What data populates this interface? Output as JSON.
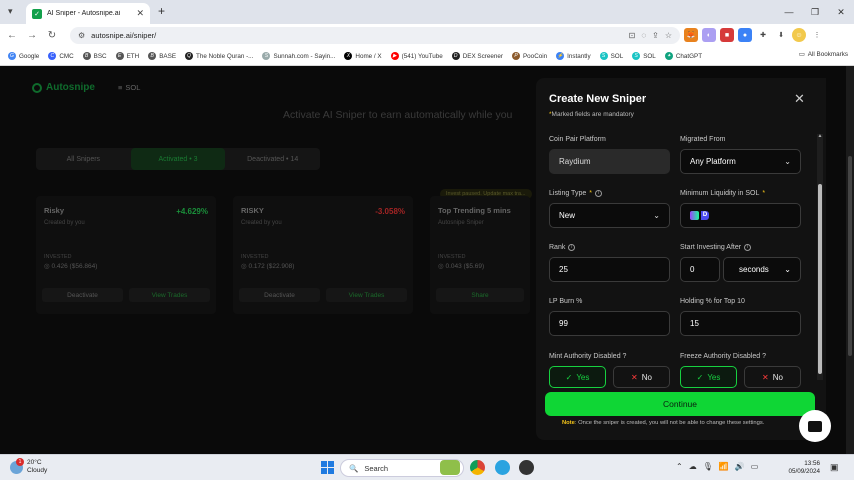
{
  "browser": {
    "tab_title": "AI Sniper - Autosnipe.ai",
    "url": "autosnipe.ai/sniper/",
    "bookmarks": [
      "Google",
      "CMC",
      "BSC",
      "ETH",
      "BASE",
      "The Noble Quran -...",
      "Sunnah.com - Sayin...",
      "Home / X",
      "(541) YouTube",
      "DEX Screener",
      "PooCoin",
      "Instantly",
      "SOL",
      "SOL",
      "ChatGPT"
    ],
    "all_bookmarks": "All Bookmarks"
  },
  "page": {
    "brand": "Autosnipe",
    "chain": "SOL",
    "headline": "Activate AI Sniper to earn automatically while you",
    "tabs": [
      "All Snipers",
      "Activated • 3",
      "Deactivated • 14"
    ],
    "cards": [
      {
        "name": "Risky",
        "creator": "Created by you",
        "pct": "+4.629%",
        "label": "INVESTED",
        "value": "◎ 0.426 ($56.864)",
        "left_btn": "Deactivate",
        "right_btn": "View Trades",
        "pct_color": "#1a8f3a"
      },
      {
        "name": "RISKY",
        "creator": "Created by you",
        "pct": "-3.058%",
        "label": "INVESTED",
        "value": "◎ 0.172 ($22.908)",
        "left_btn": "Deactivate",
        "right_btn": "View Trades",
        "pct_color": "#a32424"
      },
      {
        "name": "Top Trending 5 mins",
        "creator": "Autosnipe Sniper",
        "pct": "",
        "label": "INVESTED",
        "value": "◎ 0.043 ($5.69)",
        "left_btn": "Share",
        "right_btn": "",
        "pct_color": "#1a8f3a"
      }
    ],
    "pill": "Invest paused. Update max tra..."
  },
  "modal": {
    "title": "Create New Sniper",
    "subtitle_star": "*",
    "subtitle": "Marked fields are mandatory",
    "fields": {
      "coin_pair_platform": {
        "label": "Coin Pair Platform",
        "value": "Raydium"
      },
      "migrated_from": {
        "label": "Migrated From",
        "value": "Any Platform"
      },
      "listing_type": {
        "label": "Listing Type",
        "value": "New"
      },
      "min_liquidity": {
        "label": "Minimum Liquidity in SOL",
        "value": ""
      },
      "rank": {
        "label": "Rank",
        "value": "25"
      },
      "start_investing_after": {
        "label": "Start Investing After",
        "value": "0",
        "unit": "seconds"
      },
      "lp_burn": {
        "label": "LP Burn %",
        "value": "99"
      },
      "holding_top10": {
        "label": "Holding % for Top 10",
        "value": "15"
      },
      "mint_authority": {
        "label": "Mint Authority Disabled ?",
        "yes": "Yes",
        "no": "No",
        "selected": "Yes"
      },
      "freeze_authority": {
        "label": "Freeze Authority Disabled ?",
        "yes": "Yes",
        "no": "No",
        "selected": "Yes"
      }
    },
    "continue_label": "Continue",
    "note_label": "Note",
    "note_text": ": Once the sniper is created, you will not be able to change these settings."
  },
  "taskbar": {
    "temp": "20°C",
    "weather": "Cloudy",
    "weather_badge": "1",
    "search": "Search",
    "time": "13:56",
    "date": "05/09/2024"
  },
  "colors": {
    "accent_green": "#0fd635",
    "required_star": "#f5c518",
    "no_x": "#ff3b3b"
  }
}
